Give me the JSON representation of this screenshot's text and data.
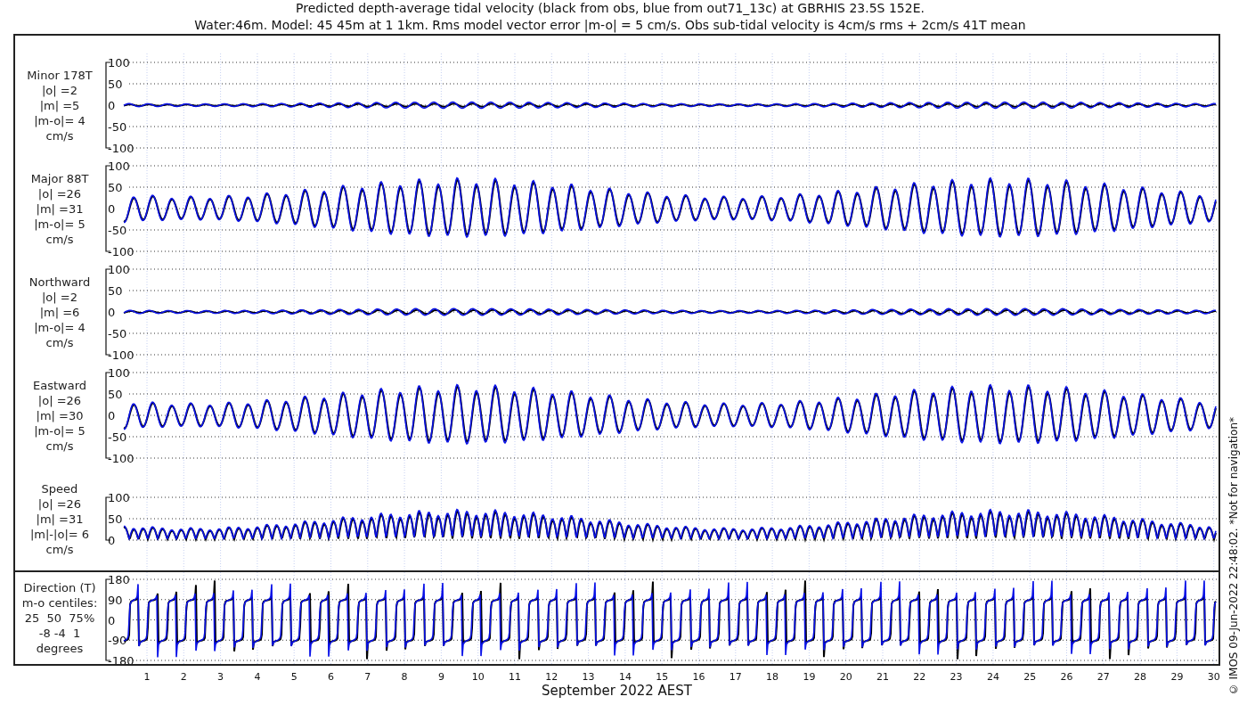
{
  "title": [
    "Predicted depth-average tidal velocity (black from obs, blue from out71_13c) at GBRHIS 23.5S 152E.",
    "Water:46m. Model: 45 45m at 1 1km. Rms model vector error |m-o| = 5 cm/s. Obs sub-tidal velocity is 4cm/s rms + 2cm/s 41T mean"
  ],
  "panels": [
    {
      "kind": "minor",
      "label": [
        "Minor 178T",
        "|o| =2",
        "|m| =5",
        "|m-o|= 4",
        "cm/s"
      ],
      "yticks": [
        "100",
        "50",
        "0",
        "-50",
        "-100"
      ]
    },
    {
      "kind": "major",
      "label": [
        "Major 88T",
        "|o| =26",
        "|m| =31",
        "|m-o|= 5",
        "cm/s"
      ],
      "yticks": [
        "100",
        "50",
        "0",
        "-50",
        "-100"
      ]
    },
    {
      "kind": "north",
      "label": [
        "Northward",
        "|o| =2",
        "|m| =6",
        "|m-o|= 4",
        "cm/s"
      ],
      "yticks": [
        "100",
        "50",
        "0",
        "-50",
        "-100"
      ]
    },
    {
      "kind": "east",
      "label": [
        "Eastward",
        "|o| =26",
        "|m| =30",
        "|m-o|= 5",
        "cm/s"
      ],
      "yticks": [
        "100",
        "50",
        "0",
        "-50",
        "-100"
      ]
    },
    {
      "kind": "speed",
      "label": [
        "Speed",
        "|o| =26",
        "|m| =31",
        "|m|-|o|= 6",
        "cm/s"
      ],
      "yticks": [
        "100",
        "50",
        "0"
      ]
    }
  ],
  "direction_panel": {
    "kind": "direction",
    "label": [
      "Direction (T)",
      "m-o centiles:",
      "25  50  75%",
      "-8 -4  1",
      "degrees"
    ],
    "yticks": [
      "180",
      "90",
      "0",
      "-90",
      "-180"
    ]
  },
  "xticks": [
    "1",
    "2",
    "3",
    "4",
    "5",
    "6",
    "7",
    "8",
    "9",
    "10",
    "11",
    "12",
    "13",
    "14",
    "15",
    "16",
    "17",
    "18",
    "19",
    "20",
    "21",
    "22",
    "23",
    "24",
    "25",
    "26",
    "27",
    "28",
    "29",
    "30"
  ],
  "xlabel": "September 2022 AEST",
  "footer": "© IMOS 09-Jun-2022 22:48:02. *Not for navigation*"
}
